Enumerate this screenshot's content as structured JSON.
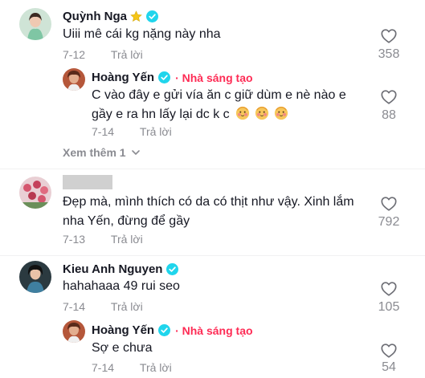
{
  "comments": [
    {
      "username": "Quỳnh Nga",
      "text": "Uiii mê cái kg nặng này nha",
      "date": "7-12",
      "reply_label": "Trả lời",
      "likes": "358",
      "replies": [
        {
          "username": "Hoàng Yến",
          "creator_tag": "Nhà sáng tạo",
          "text_line1": "C vào đây e gửi vía ăn c giữ dùm e nè nào e",
          "text_line2": "gầy e ra hn lấy lại dc k c",
          "date": "7-14",
          "reply_label": "Trả lời",
          "likes": "88"
        }
      ],
      "view_more": "Xem thêm 1"
    },
    {
      "text_line1": "Đẹp mà, mình thích có da có thịt như vậy. Xinh lắm",
      "text_line2": "nha Yến, đừng để gầy",
      "date": "7-13",
      "reply_label": "Trả lời",
      "likes": "792"
    },
    {
      "username": "Kieu Anh Nguyen",
      "text": "hahahaaa 49 rui seo",
      "date": "7-14",
      "reply_label": "Trả lời",
      "likes": "105",
      "replies": [
        {
          "username": "Hoàng Yến",
          "creator_tag": "Nhà sáng tạo",
          "text": "Sợ e chưa",
          "date": "7-14",
          "reply_label": "Trả lời",
          "likes": "54"
        }
      ]
    }
  ],
  "colors": {
    "creator_tag": "#fe2c55",
    "verified": "#20d5ec",
    "meta": "#8a8b91",
    "text": "#161823"
  }
}
